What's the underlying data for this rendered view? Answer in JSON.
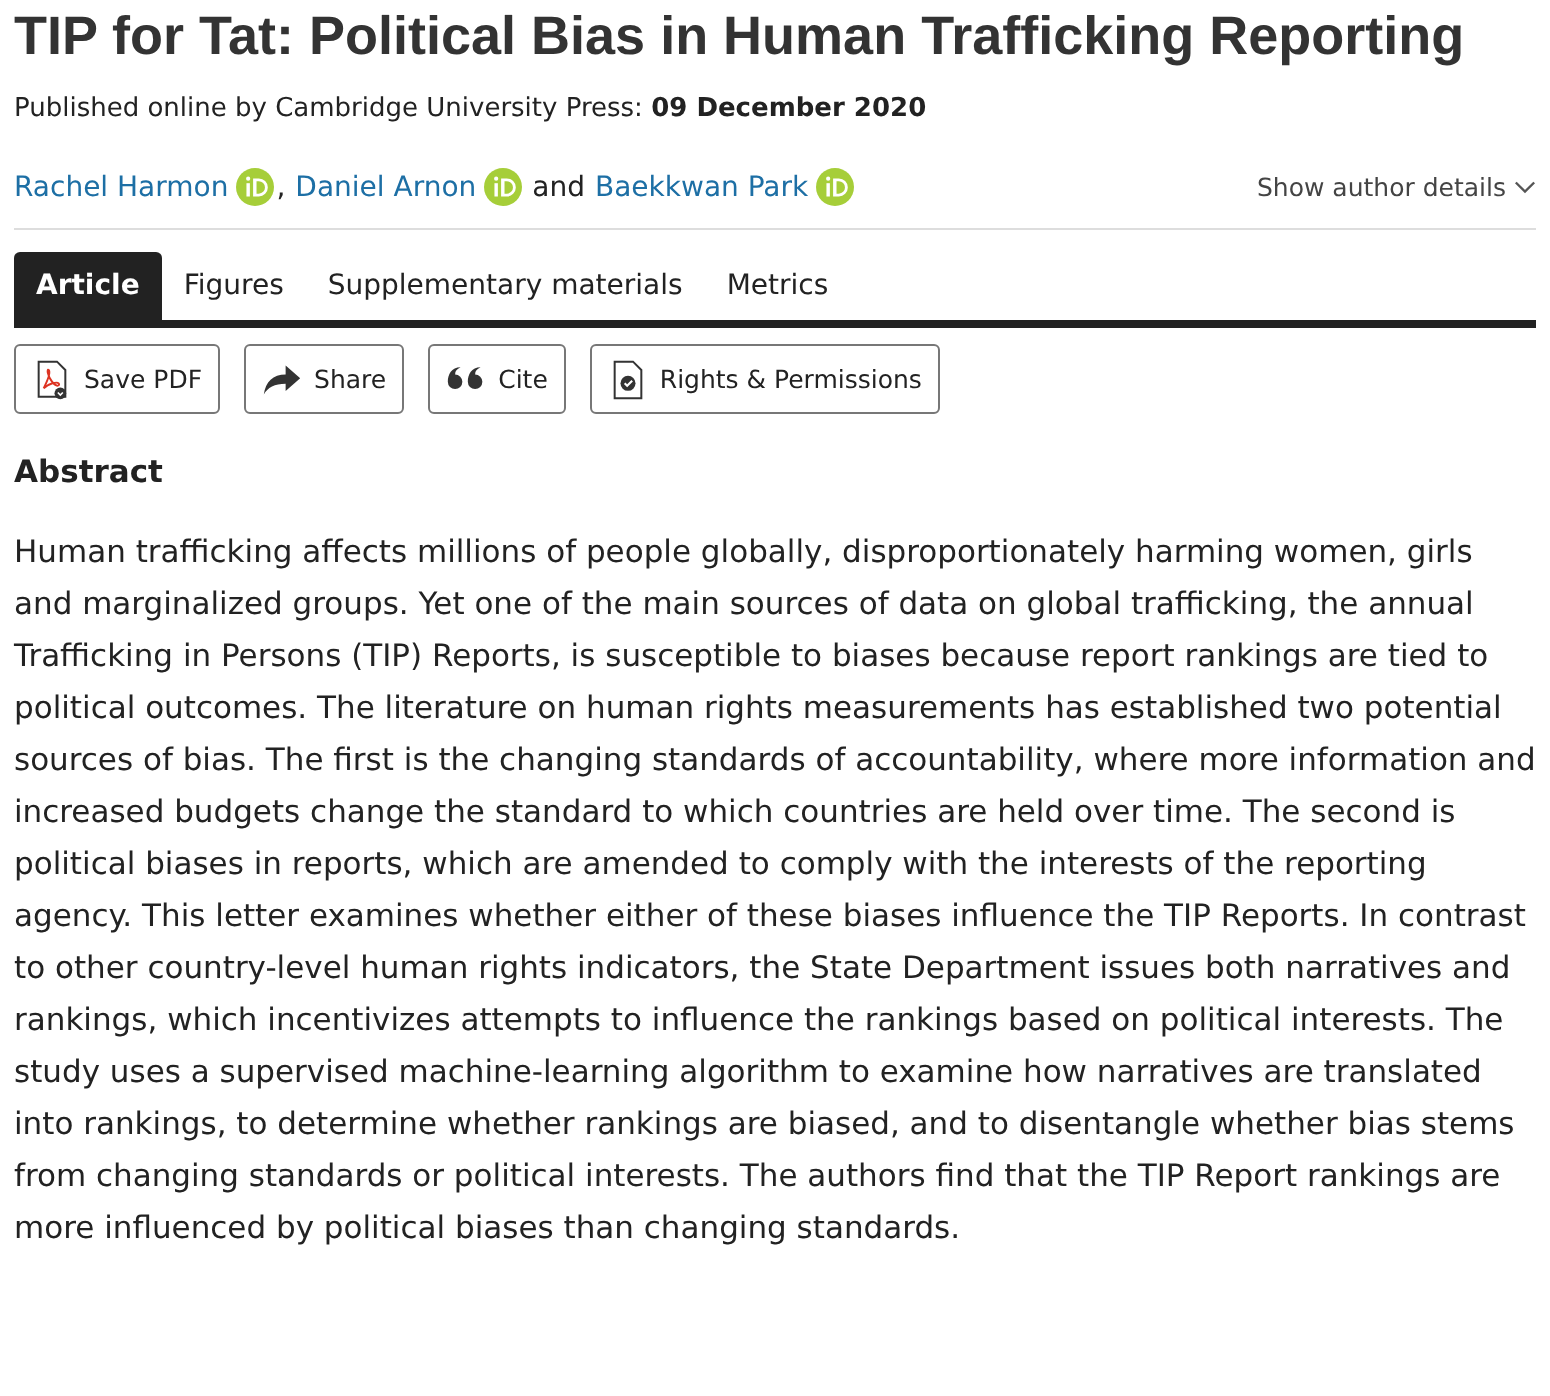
{
  "title": "TIP for Tat: Political Bias in Human Trafficking Reporting",
  "published": "Published online by Cambridge University Press:  **09 December 2020**",
  "authors": [
    {
      "name": "Rachel Harmon",
      "orcid": true,
      "separator": ","
    },
    {
      "name": "Daniel Arnon",
      "orcid": true,
      "separator": "and"
    },
    {
      "name": "Baekkwan Park",
      "orcid": true
    }
  ],
  "show_author_details": "Show author details",
  "tabs": [
    {
      "label": "Article",
      "selected": true
    },
    {
      "label": "Figures",
      "selected": false
    },
    {
      "label": "Supplementary materials",
      "selected": false
    },
    {
      "label": "Metrics",
      "selected": false
    }
  ],
  "actions": [
    {
      "kind": "pdf",
      "label": "Save PDF"
    },
    {
      "kind": "share",
      "label": "Share"
    },
    {
      "kind": "cite",
      "label": "Cite"
    },
    {
      "kind": "rights",
      "label": "Rights & Permissions"
    }
  ],
  "abstract": {
    "heading": "Abstract",
    "text": "Human trafficking affects millions of people globally, disproportionately harming women, girls and marginalized groups. Yet one of the main sources of data on global trafficking, the annual Trafficking in Persons (TIP) Reports, is susceptible to biases because report rankings are tied to political outcomes. The literature on human rights measurements has established two potential sources of bias. The first is the changing standards of accountability, where more information and increased budgets change the standard to which countries are held over time. The second is political biases in reports, which are amended to comply with the interests of the reporting agency. This letter examines whether either of these biases influence the TIP Reports. In contrast to other country-level human rights indicators, the State Department issues both narratives and rankings, which incentivizes attempts to influence the rankings based on political interests. The study uses a supervised machine-learning algorithm to examine how narratives are translated into rankings, to determine whether rankings are biased, and to disentangle whether bias stems from changing standards or political interests. The authors find that the TIP Report rankings are more influenced by political biases than changing standards."
  }
}
